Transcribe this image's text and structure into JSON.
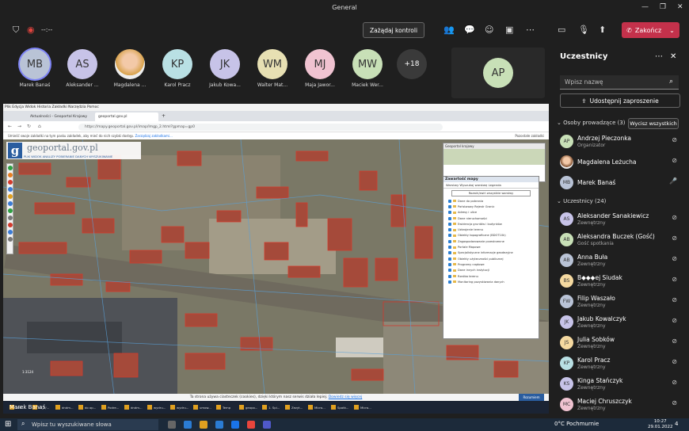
{
  "window": {
    "title": "General"
  },
  "toolbar": {
    "timer": "--:--",
    "take_control_label": "Zażądaj kontroli",
    "end_label": "Zakończ"
  },
  "strip": [
    {
      "initials": "MB",
      "name": "Marek Banaś",
      "color": "#b9c3d6"
    },
    {
      "initials": "AS",
      "name": "Aleksander ...",
      "color": "#c7c3e8"
    },
    {
      "initials": "",
      "name": "Magdalena ...",
      "color": "#f3c9a8"
    },
    {
      "initials": "KP",
      "name": "Karol Pracz",
      "color": "#b9e0e4"
    },
    {
      "initials": "JK",
      "name": "Jakub Kowa...",
      "color": "#c7c3e8"
    },
    {
      "initials": "WM",
      "name": "Walter Mat...",
      "color": "#e7e0b3"
    },
    {
      "initials": "MJ",
      "name": "Maja Jawor...",
      "color": "#f0c3d1"
    },
    {
      "initials": "MW",
      "name": "Maciek Wer...",
      "color": "#c8e0b7"
    }
  ],
  "overflow_count": "+18",
  "ap_tile": {
    "initials": "AP",
    "color": "#c8e0b7"
  },
  "browser": {
    "menu": "Plik   Edycja   Widok   Historia   Zakładki   Narzędzia   Pomoc",
    "tab1": "Aktualności - Geoportal Krajowy",
    "tab2": "geoportal.gov.pl",
    "url": "https://mapy.geoportal.gov.pl/imap/Imgp_2.html?gpmap=gp0",
    "bookmarks_hint": "Umieść swoje zakładki na tym pasku zakładek, aby mieć do nich szybki dostęp.",
    "bookmarks_link": "Zarządzaj zakładkami...",
    "other_bookmarks": "Pozostałe zakładki"
  },
  "geoportal": {
    "logo": "geoportal.gov.pl",
    "nav": "PLIK   WIDOK   ANALIZY   POBIERANIE DANYCH   WYSZUKIWANIE",
    "minimap_title": "Geoportal krajowy",
    "contents_title": "Zawartość mapy",
    "tabs": "Warstwy   Wyszukaj warstwę   Legenda",
    "collapse_btn": "Rozwiń/zwiń wszystkie warstwy",
    "layers": [
      "Dane do pobrania",
      "Państwowy Rejestr Granic",
      "Adresy i ulice",
      "Dane nieruchomości",
      "Ewidencja gruntów i budynków",
      "Uzbrojenie terenu",
      "Obiekty topograficzne (BDOT10k)",
      "Zagospodarowanie przestrzenne",
      "Portale Mapowe",
      "Specjalistyczne informacje geodezyjne",
      "Obiekty użyteczności publicznej",
      "Programy rządowe",
      "Dane innych instytucji",
      "Rzeźba terenu",
      "Monitoring pozyskiwania danych"
    ],
    "scale": "1:3124",
    "cookie_text": "Ta strona używa ciasteczek (cookies), dzięki którym nasz serwis działa lepiej.",
    "cookie_link": "Dowiedz się więcej",
    "cookie_accept": "Rozumiem"
  },
  "inner_taskbar": [
    "SotP...",
    "zs_7/...",
    "dndm...",
    "do op...",
    "Podre...",
    "dndm...",
    "wydru...",
    "wydru...",
    "umow...",
    "Temp",
    "geopo...",
    "1. Spi...",
    "Zezyt...",
    "Micro...",
    "Spotk...",
    "Micro..."
  ],
  "presenter": "Marek Banaś",
  "panel": {
    "title": "Uczestnicy",
    "search_placeholder": "Wpisz nazwę",
    "invite": "Udostępnij zaproszenie",
    "organizers_label": "Osoby prowadzące (3)",
    "mute_all": "Wycisz wszystkich",
    "organizers": [
      {
        "initials": "AP",
        "name": "Andrzej Pieczonka",
        "sub": "Organizator",
        "color": "#c8e0b7"
      },
      {
        "initials": "",
        "name": "Magdalena Leżucha",
        "sub": "",
        "color": "#f3c9a8"
      },
      {
        "initials": "MB",
        "name": "Marek Banaś",
        "sub": "",
        "color": "#b9c3d6"
      }
    ],
    "attendees_label": "Uczestnicy (24)",
    "attendees": [
      {
        "initials": "AS",
        "name": "Aleksander Sanakiewicz",
        "sub": "Zewnętrzny",
        "color": "#c7c3e8"
      },
      {
        "initials": "AB",
        "name": "Aleksandra Buczek (Gość)",
        "sub": "Gość spotkania",
        "color": "#c8e0b7"
      },
      {
        "initials": "AB",
        "name": "Anna Buła",
        "sub": "Zewnętrzny",
        "color": "#b9c3d6"
      },
      {
        "initials": "BS",
        "name": "B◆◆◆ej Siudak",
        "sub": "Zewnętrzny",
        "color": "#f5d9a0"
      },
      {
        "initials": "FW",
        "name": "Filip Waszało",
        "sub": "Zewnętrzny",
        "color": "#b9c3d6"
      },
      {
        "initials": "JK",
        "name": "Jakub Kowalczyk",
        "sub": "Zewnętrzny",
        "color": "#c7c3e8"
      },
      {
        "initials": "JS",
        "name": "Julia Sobków",
        "sub": "Zewnętrzny",
        "color": "#f5d9a0"
      },
      {
        "initials": "KP",
        "name": "Karol Pracz",
        "sub": "Zewnętrzny",
        "color": "#b9e0e4"
      },
      {
        "initials": "KS",
        "name": "Kinga Stańczyk",
        "sub": "Zewnętrzny",
        "color": "#c7c3e8"
      },
      {
        "initials": "MC",
        "name": "Maciej Chruszczyk",
        "sub": "Zewnętrzny",
        "color": "#f0c3d1"
      }
    ]
  },
  "taskbar": {
    "search_placeholder": "Wpisz tu wyszukiwane słowa",
    "weather": "0°C  Pochmurnie",
    "time": "10:27",
    "date": "29.01.2022",
    "notif": "4"
  }
}
